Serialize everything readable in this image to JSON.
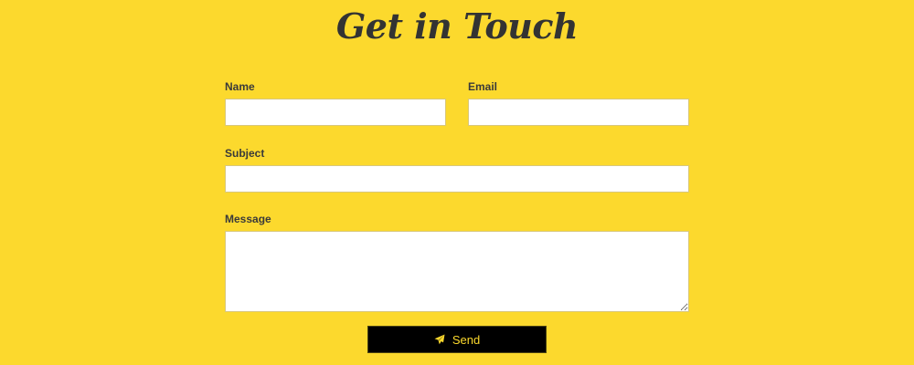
{
  "page": {
    "heading": "Get in Touch"
  },
  "form": {
    "name_label": "Name",
    "name_value": "",
    "email_label": "Email",
    "email_value": "",
    "subject_label": "Subject",
    "subject_value": "",
    "message_label": "Message",
    "message_value": "",
    "send_label": "Send",
    "send_icon": "paper-plane-icon"
  },
  "colors": {
    "background": "#fcd92d",
    "button_bg": "#000000",
    "button_text": "#fcd92d",
    "heading": "#333333"
  }
}
